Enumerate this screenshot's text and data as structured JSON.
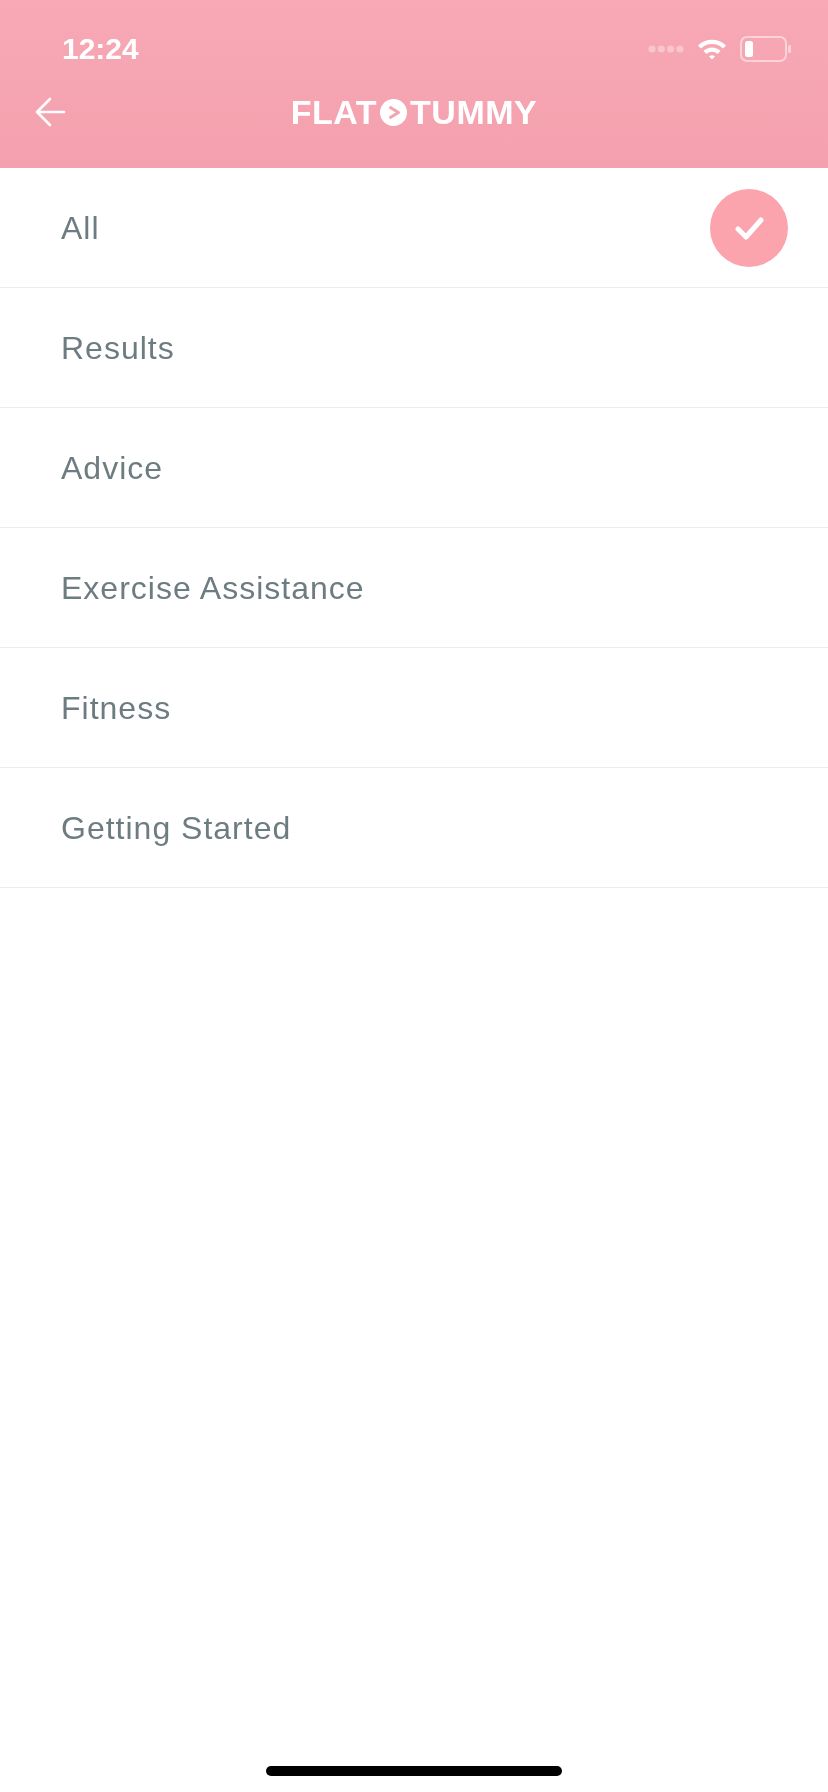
{
  "status_bar": {
    "time": "12:24"
  },
  "header": {
    "logo": {
      "left": "FLAT",
      "right": "TUMMY"
    }
  },
  "items": [
    {
      "label": "All",
      "selected": true
    },
    {
      "label": "Results",
      "selected": false
    },
    {
      "label": "Advice",
      "selected": false
    },
    {
      "label": "Exercise Assistance",
      "selected": false
    },
    {
      "label": "Fitness",
      "selected": false
    },
    {
      "label": "Getting Started",
      "selected": false
    }
  ]
}
